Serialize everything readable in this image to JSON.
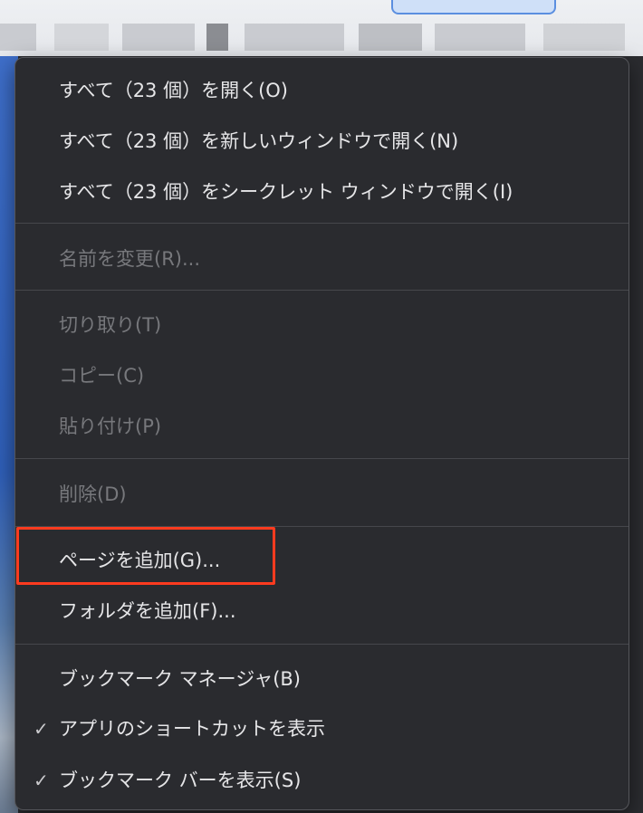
{
  "menu": {
    "items": [
      {
        "label": "すべて（23 個）を開く(O)",
        "enabled": true
      },
      {
        "label": "すべて（23 個）を新しいウィンドウで開く(N)",
        "enabled": true
      },
      {
        "label": "すべて（23 個）をシークレット ウィンドウで開く(I)",
        "enabled": true
      },
      {
        "label": "名前を変更(R)...",
        "enabled": false
      },
      {
        "label": "切り取り(T)",
        "enabled": false
      },
      {
        "label": "コピー(C)",
        "enabled": false
      },
      {
        "label": "貼り付け(P)",
        "enabled": false
      },
      {
        "label": "削除(D)",
        "enabled": false
      },
      {
        "label": "ページを追加(G)...",
        "enabled": true,
        "highlighted": true
      },
      {
        "label": "フォルダを追加(F)...",
        "enabled": true
      },
      {
        "label": "ブックマーク マネージャ(B)",
        "enabled": true
      },
      {
        "label": "アプリのショートカットを表示",
        "enabled": true,
        "checked": true
      },
      {
        "label": "ブックマーク バーを表示(S)",
        "enabled": true,
        "checked": true
      }
    ],
    "check_glyph": "✓"
  },
  "colors": {
    "menu_background": "#2a2b2f",
    "text_enabled": "#e6e6e8",
    "text_disabled": "#77787c",
    "highlight_border": "#ff3b1f"
  }
}
